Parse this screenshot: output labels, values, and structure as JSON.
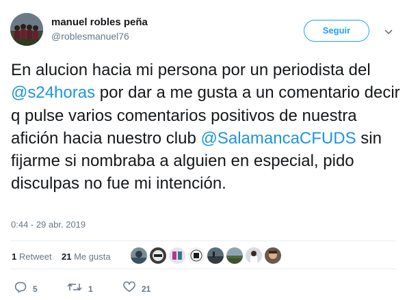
{
  "header": {
    "display_name": "manuel robles peña",
    "handle": "@roblesmanuel76",
    "follow_label": "Seguir"
  },
  "tweet": {
    "segments": [
      {
        "text": "En alucion hacia mi persona por un periodista del ",
        "link": false
      },
      {
        "text": "@s24horas",
        "link": true
      },
      {
        "text": " por dar a me gusta a un comentario decir q pulse varios comentarios positivos de nuestra afición hacia nuestro club ",
        "link": false
      },
      {
        "text": "@SalamancaCFUDS",
        "link": true
      },
      {
        "text": " sin fijarme si nombraba a alguien en especial, pido disculpas no fue mi intención.",
        "link": false
      }
    ],
    "timestamp": "0:44 - 29 abr. 2019"
  },
  "stats": {
    "retweets_count": "1",
    "retweets_label": "Retweet",
    "likes_count": "21",
    "likes_label": "Me gusta"
  },
  "likers": [
    {
      "icon": "liker-avatar-1"
    },
    {
      "icon": "liker-avatar-2"
    },
    {
      "icon": "liker-avatar-3"
    },
    {
      "icon": "liker-avatar-4"
    },
    {
      "icon": "liker-avatar-5"
    },
    {
      "icon": "liker-avatar-6"
    },
    {
      "icon": "liker-avatar-7"
    },
    {
      "icon": "liker-avatar-8"
    }
  ],
  "actions": {
    "reply_count": "5",
    "retweet_count": "1",
    "like_count": "21"
  },
  "colors": {
    "accent": "#1da1f2",
    "link": "#1b95e0",
    "muted": "#657786",
    "divider": "#e6ecf0"
  }
}
